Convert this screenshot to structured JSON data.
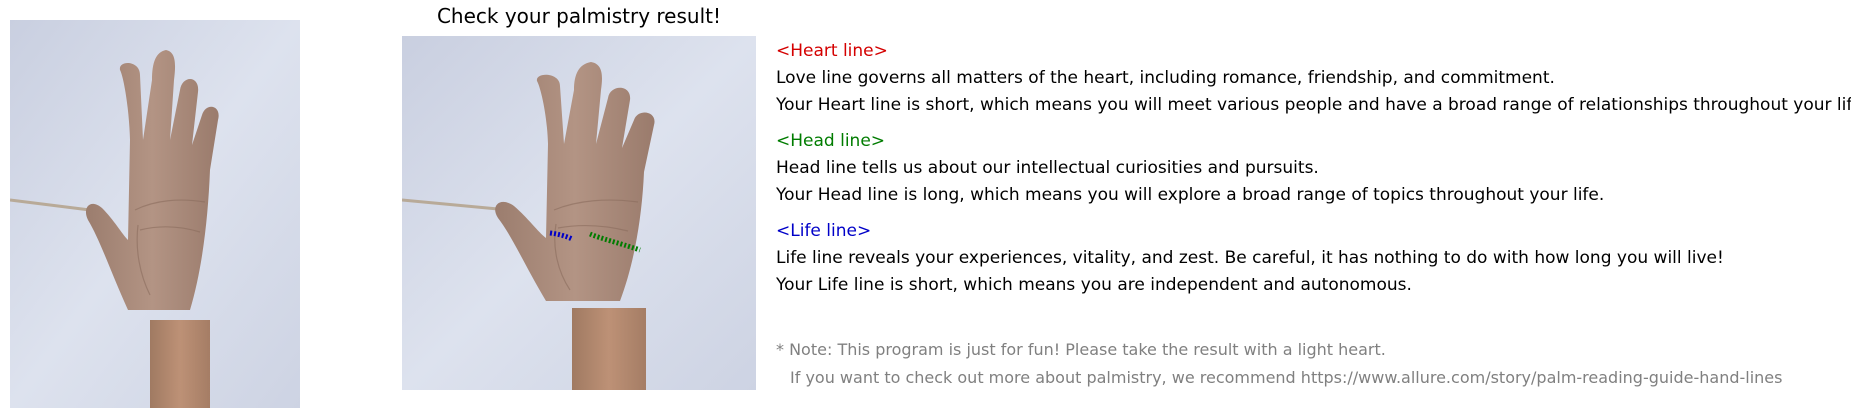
{
  "title": "Check your palmistry result!",
  "images": {
    "original": {
      "label": "original-palm-photo"
    },
    "annotated": {
      "label": "annotated-palm-photo"
    }
  },
  "colors": {
    "heart": "#d40000",
    "head": "#007c00",
    "life": "#0000c8",
    "note": "#808080",
    "background": "#ffffff"
  },
  "heart": {
    "heading": "<Heart line>",
    "description": "Love line governs all matters of the heart, including romance, friendship, and commitment.",
    "result": "Your Heart line is short, which means you will meet various people and have a broad range of relationships throughout your life."
  },
  "head": {
    "heading": "<Head line>",
    "description": "Head line tells us about our intellectual curiosities and pursuits.",
    "result": "Your Head line is long, which means you will explore a broad range of topics throughout your life."
  },
  "life": {
    "heading": "<Life line>",
    "description": "Life line reveals your experiences, vitality, and zest. Be careful, it has nothing to do with how long you will live!",
    "result": "Your Life line is short, which means you are independent and autonomous."
  },
  "note": {
    "line1": "* Note: This program is just for fun! Please take the result with a light heart.",
    "line2": "If you want to check out more about palmistry, we recommend https://www.allure.com/story/palm-reading-guide-hand-lines"
  }
}
